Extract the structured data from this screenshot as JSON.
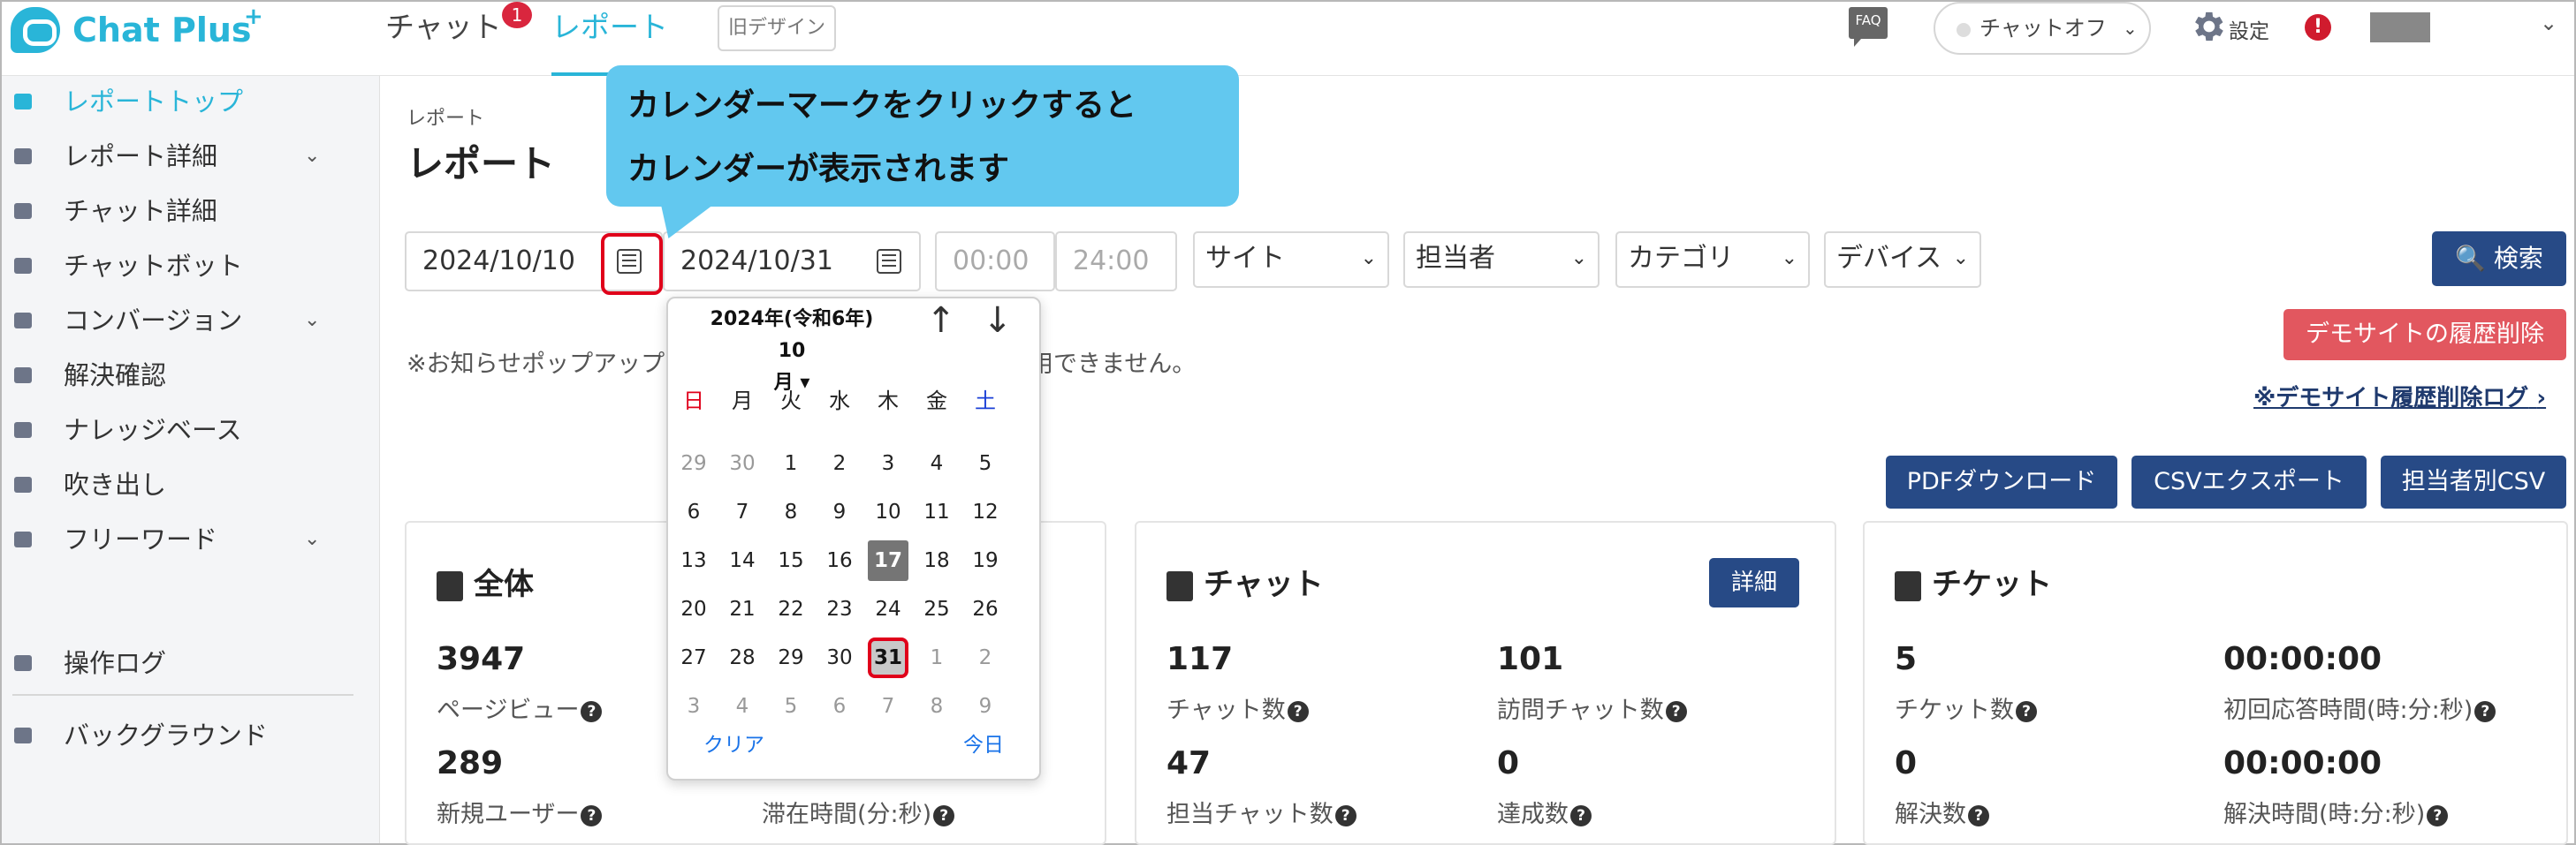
{
  "app": {
    "logo_text": "Chat Plus",
    "logo_plus": "+"
  },
  "topbar": {
    "tab_chat": "チャット",
    "tab_chat_badge": "1",
    "tab_report": "レポート",
    "old_design": "旧デザイン",
    "faq": "FAQ",
    "status": "チャットオフ",
    "settings": "設定",
    "alert": "!"
  },
  "sidebar": {
    "items": [
      {
        "label": "レポートトップ",
        "active": true,
        "expand": false,
        "icon": "dashboard-icon"
      },
      {
        "label": "レポート詳細",
        "active": false,
        "expand": true,
        "icon": "bar-chart-icon"
      },
      {
        "label": "チャット詳細",
        "active": false,
        "expand": false,
        "icon": "chat-bubbles-icon"
      },
      {
        "label": "チャットボット",
        "active": false,
        "expand": false,
        "icon": "bot-icon"
      },
      {
        "label": "コンバージョン",
        "active": false,
        "expand": true,
        "icon": "star-icon"
      },
      {
        "label": "解決確認",
        "active": false,
        "expand": false,
        "icon": "lightbulb-icon"
      },
      {
        "label": "ナレッジベース",
        "active": false,
        "expand": false,
        "icon": "book-icon"
      },
      {
        "label": "吹き出し",
        "active": false,
        "expand": false,
        "icon": "speech-bubble-icon"
      },
      {
        "label": "フリーワード",
        "active": false,
        "expand": true,
        "icon": "text-abc-icon"
      },
      {
        "label": "操作ログ",
        "active": false,
        "expand": false,
        "icon": "list-icon"
      },
      {
        "label": "バックグラウンド",
        "active": false,
        "expand": false,
        "icon": "background-icon"
      }
    ]
  },
  "main": {
    "breadcrumb": "レポート",
    "title": "レポート",
    "date_from": "2024/10/10",
    "date_to": "2024/10/31",
    "time_from_placeholder": "00:00",
    "time_to_placeholder": "24:00",
    "filters": {
      "site": "サイト",
      "agent": "担当者",
      "category": "カテゴリ",
      "device": "デバイス"
    },
    "search": "検索",
    "notice_left": "※お知らせポップアップ",
    "notice_right": "利用できません。",
    "demo_delete": "デモサイトの履歴削除",
    "demo_log": "※デモサイト履歴削除ログ",
    "pdf_download": "PDFダウンロード",
    "csv_export": "CSVエクスポート",
    "agent_csv": "担当者別CSV"
  },
  "cards": {
    "all": {
      "title": "全体",
      "page_views_value": "3947",
      "page_views_label": "ページビュー",
      "new_users_value": "289",
      "new_users_label": "新規ユーザー",
      "stay_time_label": "滞在時間(分:秒)"
    },
    "chat": {
      "title": "チャット",
      "detail": "詳細",
      "chats_value": "117",
      "chats_label": "チャット数",
      "visit_chats_value": "101",
      "visit_chats_label": "訪問チャット数",
      "agent_chats_value": "47",
      "agent_chats_label": "担当チャット数",
      "achieved_value": "0",
      "achieved_label": "達成数"
    },
    "ticket": {
      "title": "チケット",
      "tickets_value": "5",
      "tickets_label": "チケット数",
      "first_response_value": "00:00:00",
      "first_response_label": "初回応答時間(時:分:秒)",
      "resolved_value": "0",
      "resolved_label": "解決数",
      "resolve_time_value": "00:00:00",
      "resolve_time_label": "解決時間(時:分:秒)"
    }
  },
  "callout": {
    "line1": "カレンダーマークをクリックすると",
    "line2": "カレンダーが表示されます",
    "color": "#62c8ef"
  },
  "calendar": {
    "header_line1": "2024年(令和6年) 10",
    "header_line2": "月",
    "prev_icon": "↑",
    "next_icon": "↓",
    "weekdays": [
      "日",
      "月",
      "火",
      "水",
      "木",
      "金",
      "土"
    ],
    "weekday_colors": [
      "#e0001a",
      "#222",
      "#222",
      "#222",
      "#222",
      "#222",
      "#1a3fd6"
    ],
    "weeks": [
      [
        [
          "29",
          "out"
        ],
        [
          "30",
          "out"
        ],
        [
          "1",
          ""
        ],
        [
          "2",
          ""
        ],
        [
          "3",
          ""
        ],
        [
          "4",
          ""
        ],
        [
          "5",
          ""
        ]
      ],
      [
        [
          "6",
          ""
        ],
        [
          "7",
          ""
        ],
        [
          "8",
          ""
        ],
        [
          "9",
          ""
        ],
        [
          "10",
          ""
        ],
        [
          "11",
          ""
        ],
        [
          "12",
          ""
        ]
      ],
      [
        [
          "13",
          ""
        ],
        [
          "14",
          ""
        ],
        [
          "15",
          ""
        ],
        [
          "16",
          ""
        ],
        [
          "17",
          "today"
        ],
        [
          "18",
          ""
        ],
        [
          "19",
          ""
        ]
      ],
      [
        [
          "20",
          ""
        ],
        [
          "21",
          ""
        ],
        [
          "22",
          ""
        ],
        [
          "23",
          ""
        ],
        [
          "24",
          ""
        ],
        [
          "25",
          ""
        ],
        [
          "26",
          ""
        ]
      ],
      [
        [
          "27",
          ""
        ],
        [
          "28",
          ""
        ],
        [
          "29",
          ""
        ],
        [
          "30",
          ""
        ],
        [
          "31",
          "sel"
        ],
        [
          "1",
          "out"
        ],
        [
          "2",
          "out"
        ]
      ],
      [
        [
          "3",
          "out"
        ],
        [
          "4",
          "out"
        ],
        [
          "5",
          "out"
        ],
        [
          "6",
          "out"
        ],
        [
          "7",
          "out"
        ],
        [
          "8",
          "out"
        ],
        [
          "9",
          "out"
        ]
      ]
    ],
    "clear": "クリア",
    "today": "今日"
  }
}
